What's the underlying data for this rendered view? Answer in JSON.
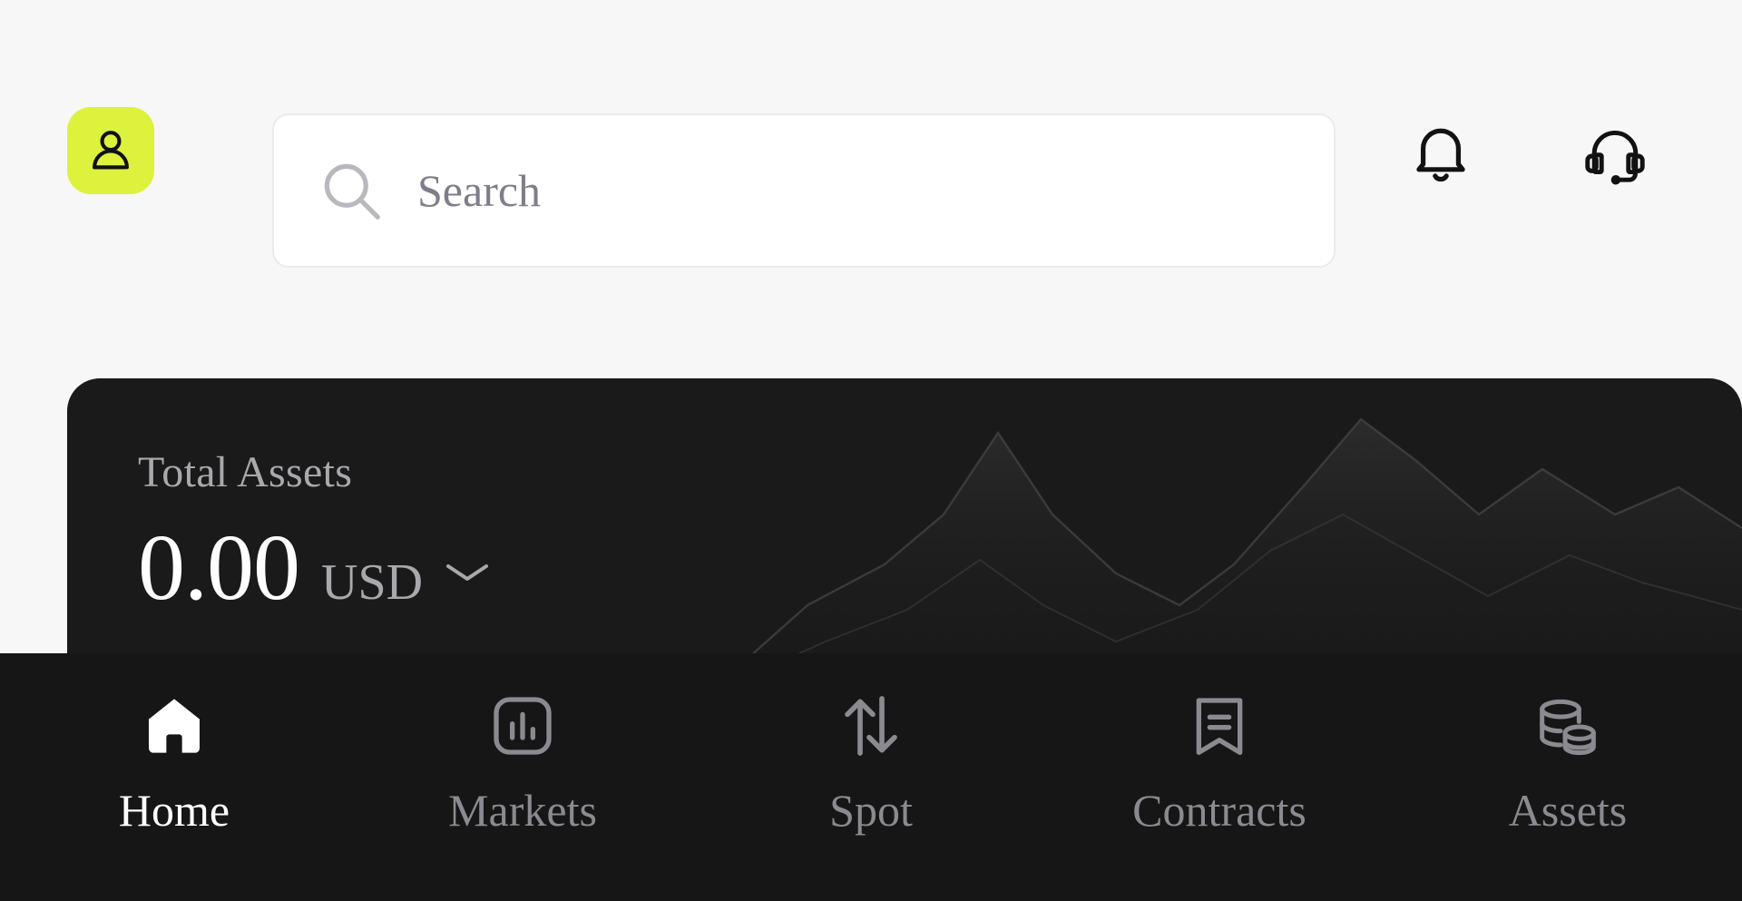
{
  "theme": {
    "page_background": "#F7F7F7",
    "accent": "#DCF23C",
    "card_background": "#1A1A1A",
    "nav_background": "#161616",
    "nav_active_color": "#FFFFFF",
    "nav_inactive_color": "#8A8A90",
    "muted_text": "#A9A9AD",
    "placeholder_color": "#7E7E8A"
  },
  "header": {
    "avatar": {
      "icon": "user-icon",
      "label": "Profile"
    },
    "search": {
      "icon": "search-icon",
      "placeholder": "Search",
      "value": ""
    },
    "actions": [
      {
        "icon": "bell-icon",
        "label": "Notifications"
      },
      {
        "icon": "headset-icon",
        "label": "Customer Support"
      }
    ]
  },
  "assets_card": {
    "label": "Total Assets",
    "value": "0.00",
    "currency": "USD",
    "currency_toggle_icon": "chevron-down-icon",
    "decoration": "mountain-line-graphic"
  },
  "bottom_nav": {
    "items": [
      {
        "label": "Home",
        "icon": "home-icon",
        "active": true
      },
      {
        "label": "Markets",
        "icon": "bar-chart-icon",
        "active": false
      },
      {
        "label": "Spot",
        "icon": "swap-arrows-icon",
        "active": false
      },
      {
        "label": "Contracts",
        "icon": "bookmark-lines-icon",
        "active": false
      },
      {
        "label": "Assets",
        "icon": "coin-stack-icon",
        "active": false
      }
    ]
  }
}
